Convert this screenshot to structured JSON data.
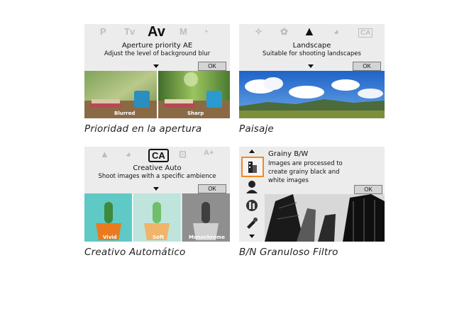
{
  "panels": {
    "av": {
      "modes": [
        "P",
        "Tv",
        "Av",
        "M",
        "◔"
      ],
      "selected_mode": "Av",
      "title": "Aperture priority AE",
      "description": "Adjust the level of background blur",
      "ok_label": "OK",
      "image_left_label": "Blurred",
      "image_right_label": "Sharp",
      "caption": "Prioridad en la apertura"
    },
    "landscape": {
      "modes": [
        "✧",
        "✿",
        "▲",
        "◕",
        "CA"
      ],
      "selected_mode": "▲",
      "title": "Landscape",
      "description": "Suitable for shooting landscapes",
      "ok_label": "OK",
      "caption": "Paisaje"
    },
    "ca": {
      "modes": [
        "▲",
        "◕",
        "CA",
        "⊡",
        "A+"
      ],
      "selected_mode": "CA",
      "title": "Creative Auto",
      "description": "Shoot images with a specific ambience",
      "ok_label": "OK",
      "image_labels": [
        "Vivid",
        "Soft",
        "Monochrome"
      ],
      "caption": "Creativo Automático"
    },
    "grainy": {
      "title": "Grainy B/W",
      "description_lines": [
        "Images are processed to",
        "create grainy black and",
        "white images"
      ],
      "ok_label": "OK",
      "caption": "B/N Granuloso Filtro"
    }
  },
  "colors": {
    "panel_bg": "#ececec",
    "selected_border": "#f08a24",
    "caption_text": "#222222"
  }
}
